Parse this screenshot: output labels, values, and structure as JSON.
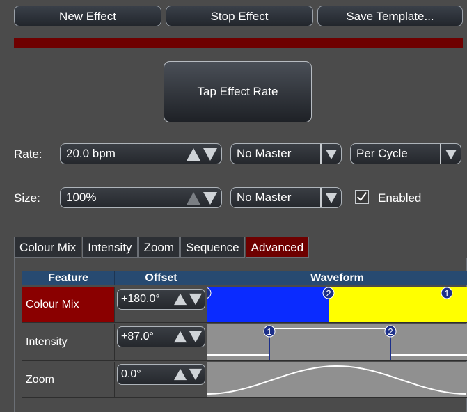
{
  "toolbar": {
    "new_effect": "New Effect",
    "stop_effect": "Stop Effect",
    "save_template": "Save Template..."
  },
  "tap_effect_rate": "Tap Effect Rate",
  "rate": {
    "label": "Rate:",
    "value": "20.0 bpm",
    "master": "No Master",
    "mode": "Per Cycle"
  },
  "size": {
    "label": "Size:",
    "value": "100%",
    "master": "No Master",
    "enabled_label": "Enabled",
    "enabled": true
  },
  "tabs": [
    {
      "label": "Colour Mix",
      "active": false
    },
    {
      "label": "Intensity",
      "active": false
    },
    {
      "label": "Zoom",
      "active": false
    },
    {
      "label": "Sequence",
      "active": false
    },
    {
      "label": "Advanced",
      "active": true
    }
  ],
  "table": {
    "headers": {
      "feature": "Feature",
      "offset": "Offset",
      "waveform": "Waveform"
    },
    "rows": [
      {
        "feature": "Colour Mix",
        "offset": "+180.0°",
        "selected": true,
        "markers": [
          "1",
          "2",
          "1"
        ]
      },
      {
        "feature": "Intensity",
        "offset": "+87.0°",
        "selected": false,
        "markers": [
          "1",
          "2"
        ]
      },
      {
        "feature": "Zoom",
        "offset": "0.0°",
        "selected": false,
        "markers": []
      }
    ]
  },
  "colors": {
    "accent_red": "#6e0000",
    "selected_row": "#8a0000",
    "header_blue": "#274a71",
    "wave_blue": "#0a2bff",
    "wave_yellow": "#ffff00",
    "wave_gray": "#909090"
  }
}
